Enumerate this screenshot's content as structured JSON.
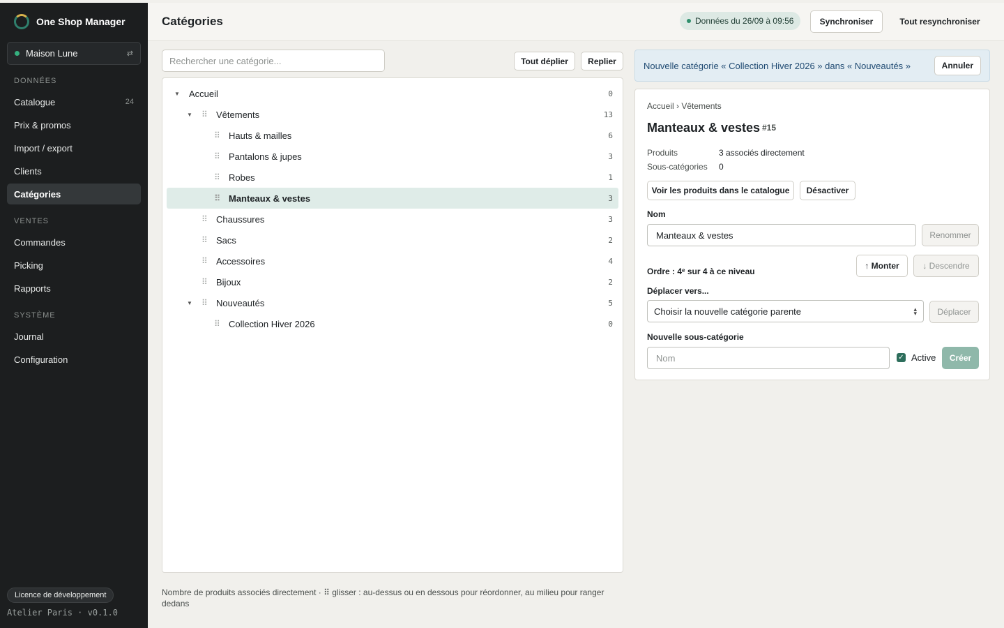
{
  "app": {
    "brand": "One Shop Manager"
  },
  "store": {
    "name": "Maison Lune",
    "switch_icon": "⇄"
  },
  "sidebar": {
    "sections": [
      {
        "title": "DONNÉES",
        "items": [
          {
            "label": "Catalogue",
            "count": "24"
          },
          {
            "label": "Prix & promos"
          },
          {
            "label": "Import / export"
          },
          {
            "label": "Clients"
          },
          {
            "label": "Catégories",
            "active": true
          }
        ]
      },
      {
        "title": "VENTES",
        "items": [
          {
            "label": "Commandes"
          },
          {
            "label": "Picking"
          },
          {
            "label": "Rapports"
          }
        ]
      },
      {
        "title": "SYSTÈME",
        "items": [
          {
            "label": "Journal"
          },
          {
            "label": "Configuration"
          }
        ]
      }
    ],
    "license": "Licence de développement",
    "version": "Atelier Paris · v0.1.0"
  },
  "header": {
    "title": "Catégories",
    "sync_status": "Données du 26/09 à 09:56",
    "sync_button": "Synchroniser",
    "resync_button": "Tout resynchroniser"
  },
  "tree": {
    "search_placeholder": "Rechercher une catégorie...",
    "expand_all": "Tout déplier",
    "collapse_all": "Replier",
    "rows": [
      {
        "label": "Accueil",
        "count": "0"
      },
      {
        "label": "Vêtements",
        "count": "13"
      },
      {
        "label": "Hauts & mailles",
        "count": "6"
      },
      {
        "label": "Pantalons & jupes",
        "count": "3"
      },
      {
        "label": "Robes",
        "count": "1"
      },
      {
        "label": "Manteaux & vestes",
        "count": "3"
      },
      {
        "label": "Chaussures",
        "count": "3"
      },
      {
        "label": "Sacs",
        "count": "2"
      },
      {
        "label": "Accessoires",
        "count": "4"
      },
      {
        "label": "Bijoux",
        "count": "2"
      },
      {
        "label": "Nouveautés",
        "count": "5"
      },
      {
        "label": "Collection Hiver 2026",
        "count": "0"
      }
    ],
    "footnote": "Nombre de produits associés directement · ⠿ glisser : au-dessus ou en dessous pour réordonner, au milieu pour ranger dedans"
  },
  "banner": {
    "text": "Nouvelle catégorie « Collection Hiver 2026 » dans « Nouveautés »",
    "cancel": "Annuler"
  },
  "detail": {
    "breadcrumb": "Accueil › Vêtements",
    "title": "Manteaux & vestes",
    "id": "#15",
    "products_label": "Produits",
    "products_value": "3 associés directement",
    "subcats_label": "Sous-catégories",
    "subcats_value": "0",
    "view_products": "Voir les produits dans le catalogue",
    "deactivate": "Désactiver",
    "name_label": "Nom",
    "name_value": "Manteaux & vestes",
    "rename": "Renommer",
    "order_text": "Ordre : 4ᵉ sur 4 à ce niveau",
    "move_up": "↑ Monter",
    "move_down": "↓ Descendre",
    "move_label": "Déplacer vers...",
    "parent_select": "Choisir la nouvelle catégorie parente",
    "move_button": "Déplacer",
    "new_sub_label": "Nouvelle sous-catégorie",
    "new_sub_placeholder": "Nom",
    "active_label": "Active",
    "create": "Créer"
  }
}
